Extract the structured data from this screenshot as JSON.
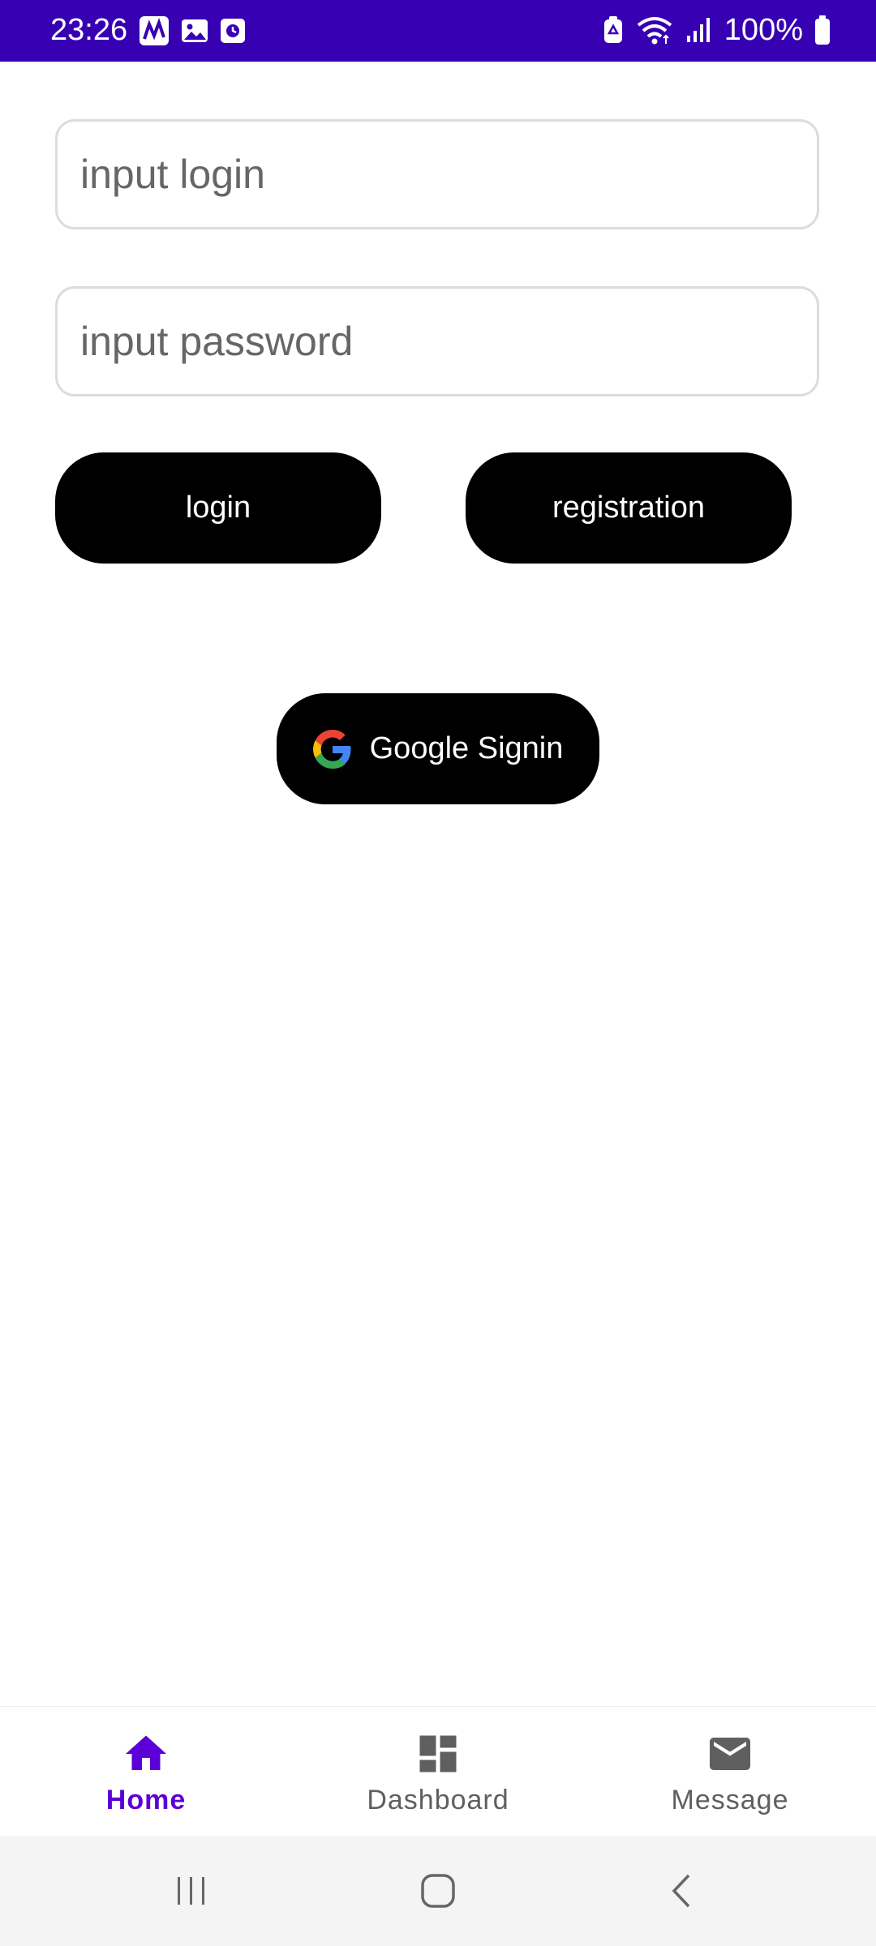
{
  "status_bar": {
    "time": "23:26",
    "battery_text": "100%",
    "background_color": "#3700b3",
    "left_icons": [
      "app-notification-icon",
      "gallery-icon",
      "clock-app-icon"
    ],
    "right_icons": [
      "battery-saver-icon",
      "wifi-icon",
      "signal-icon",
      "battery-icon"
    ]
  },
  "form": {
    "login_placeholder": "input login",
    "login_value": "",
    "password_placeholder": "input password",
    "password_value": ""
  },
  "buttons": {
    "login_label": "login",
    "registration_label": "registration",
    "google_label": "Google Signin",
    "background_color": "#000000"
  },
  "bottom_nav": {
    "active_color": "#5b00d6",
    "items": [
      {
        "label": "Home",
        "icon": "home-icon",
        "active": true
      },
      {
        "label": "Dashboard",
        "icon": "dashboard-icon",
        "active": false
      },
      {
        "label": "Message",
        "icon": "mail-icon",
        "active": false
      }
    ]
  },
  "system_nav": {
    "icons": [
      "recent-apps-icon",
      "home-button-icon",
      "back-icon"
    ]
  }
}
